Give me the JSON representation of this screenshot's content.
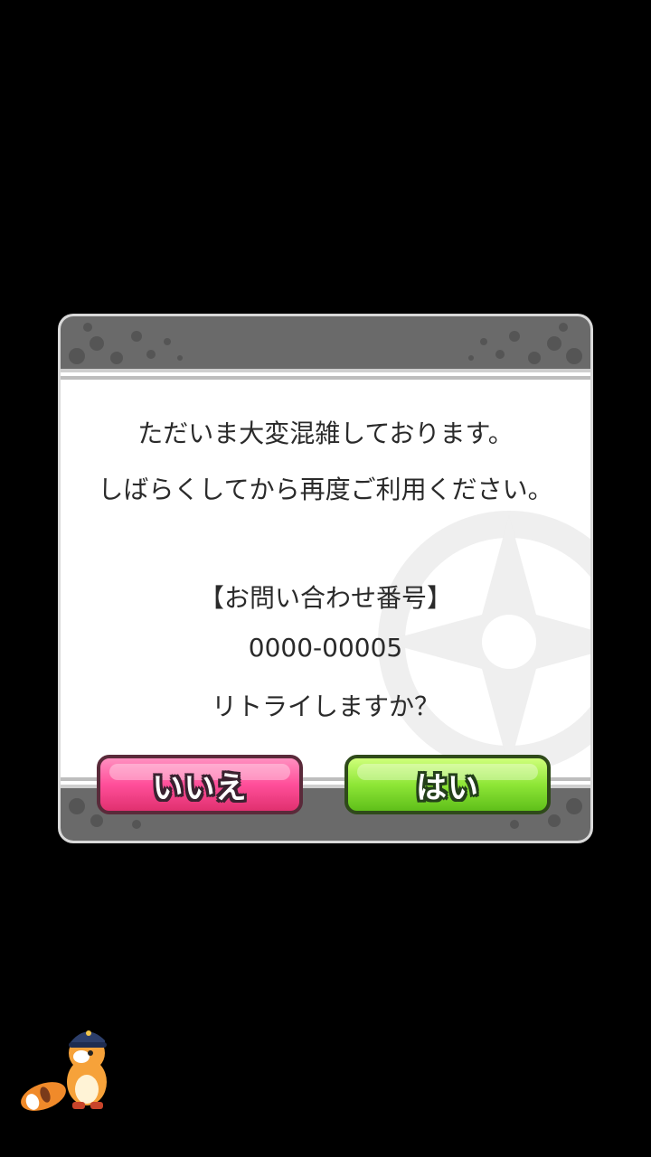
{
  "dialog": {
    "message_line1": "ただいま大変混雑しております。",
    "message_line2": "しばらくしてから再度ご利用ください。",
    "inquiry_label": "【お問い合わせ番号】",
    "inquiry_number": "0000-00005",
    "retry_question": "リトライしますか？",
    "no_button_label": "いいえ",
    "yes_button_label": "はい"
  },
  "colors": {
    "background": "#000000",
    "dialog_background": "#ffffff",
    "band": "#6a6a6a",
    "no_button": "#ff4f9a",
    "yes_button": "#8ee637"
  },
  "icons": {
    "emblem": "compass-star-emblem-icon",
    "mascot": "raccoon-mascot-icon"
  }
}
